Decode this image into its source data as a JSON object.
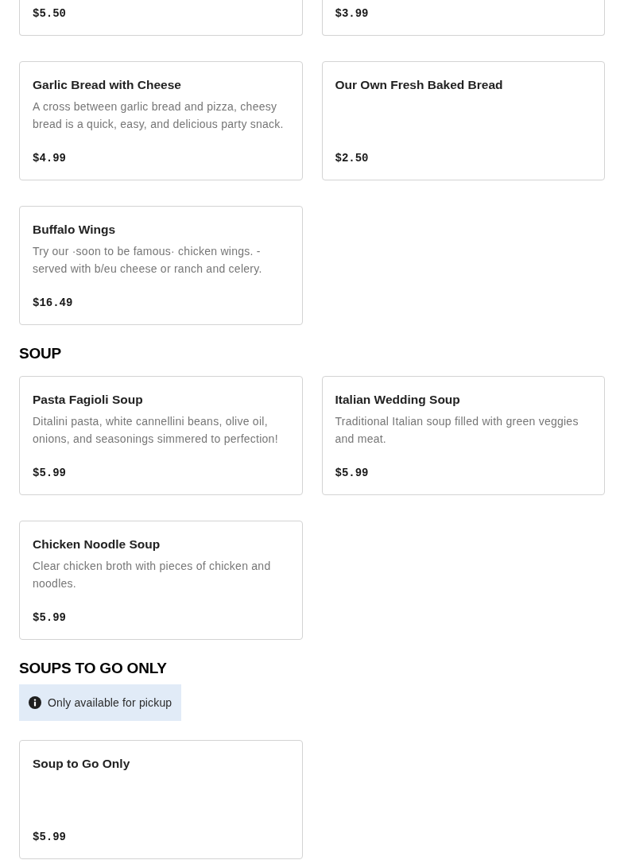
{
  "sections": [
    {
      "items": [
        {
          "price": "$5.50",
          "cut_off_top": true
        },
        {
          "price": "$3.99",
          "cut_off_top": true
        },
        {
          "name": "Garlic Bread with Cheese",
          "description": "A cross between garlic bread and pizza, cheesy bread is a quick, easy, and delicious party snack.",
          "price": "$4.99"
        },
        {
          "name": "Our Own Fresh Baked Bread",
          "price": "$2.50"
        },
        {
          "name": "Buffalo Wings",
          "description": "Try our ·soon to be famous· chicken wings. - served with b/eu cheese or ranch and celery.",
          "price": "$16.49"
        }
      ]
    },
    {
      "heading": "SOUP",
      "items": [
        {
          "name": "Pasta Fagioli Soup",
          "description": "Ditalini pasta, white cannellini beans, olive oil, onions, and seasonings simmered to perfection!",
          "price": "$5.99"
        },
        {
          "name": "Italian Wedding Soup",
          "description": "Traditional Italian soup filled with green veggies and meat.",
          "price": "$5.99"
        },
        {
          "name": "Chicken Noodle Soup",
          "description": "Clear chicken broth with pieces of chicken and noodles.",
          "price": "$5.99"
        }
      ]
    },
    {
      "heading": "SOUPS TO GO ONLY",
      "notice": "Only available for pickup",
      "items": [
        {
          "name": "Soup to Go Only",
          "price": "$5.99"
        }
      ]
    }
  ]
}
